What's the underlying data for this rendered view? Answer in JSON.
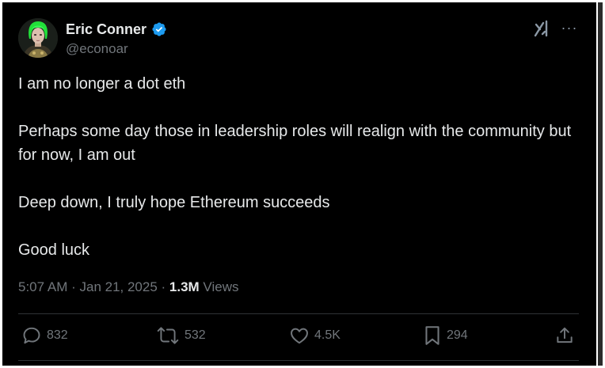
{
  "author": {
    "name": "Eric Conner",
    "handle": "@econoar",
    "verified": true
  },
  "post": {
    "paragraphs": [
      "I am no longer a dot eth",
      "Perhaps some day those in leadership roles will realign with the community but for now, I am out",
      "Deep down, I truly hope Ethereum succeeds",
      "Good luck"
    ],
    "time": "5:07 AM",
    "separator": " · ",
    "date": "Jan 21, 2025",
    "views_count": "1.3M",
    "views_label": " Views"
  },
  "actions": {
    "replies": "832",
    "reposts": "532",
    "likes": "4.5K",
    "bookmarks": "294"
  },
  "icons": {
    "grok": "grok-icon",
    "more": "more-icon",
    "reply": "reply-icon",
    "repost": "repost-icon",
    "like": "heart-icon",
    "bookmark": "bookmark-icon",
    "share": "share-icon"
  },
  "colors": {
    "background": "#000000",
    "text": "#e7e9ea",
    "secondary": "#71767b",
    "verified": "#1d9bf0"
  }
}
